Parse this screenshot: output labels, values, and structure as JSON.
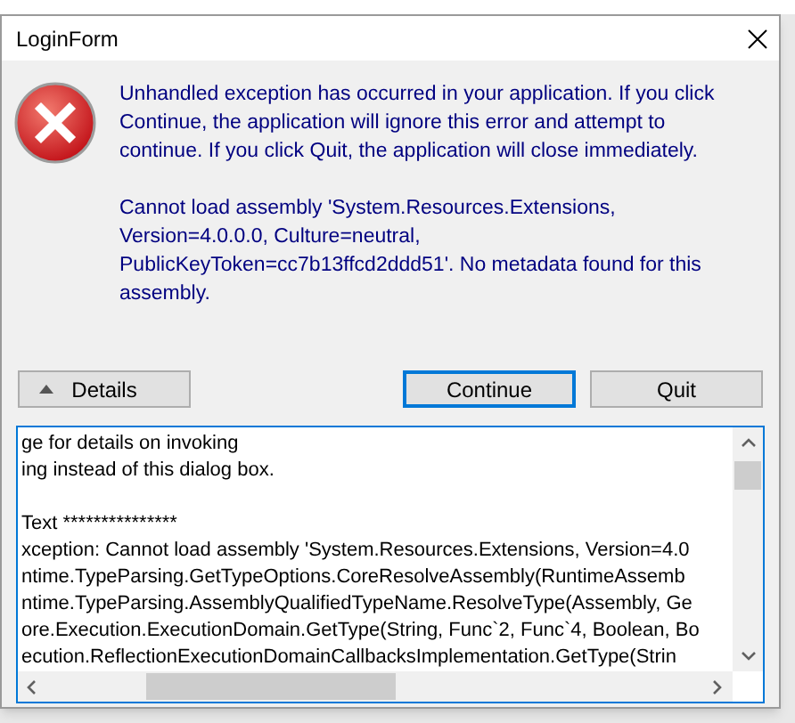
{
  "window": {
    "title": "LoginForm"
  },
  "message": [
    "Unhandled exception has occurred in your application. If you click Continue, the application will ignore this error and attempt to continue. If you click Quit, the application will close immediately.",
    "Cannot load assembly 'System.Resources.Extensions, Version=4.0.0.0, Culture=neutral, PublicKeyToken=cc7b13ffcd2ddd51'. No metadata found for this assembly."
  ],
  "buttons": [
    {
      "label": "Details",
      "kind": "toggle",
      "focused": false
    },
    {
      "label": "Continue",
      "kind": "plain",
      "focused": true
    },
    {
      "label": "Quit",
      "kind": "plain",
      "focused": false
    }
  ],
  "details_paragraphs": [
    [
      "ge for details on invoking",
      "ing instead of this dialog box."
    ],
    [
      "Text ***************",
      "xception: Cannot load assembly 'System.Resources.Extensions, Version=4.0",
      "ntime.TypeParsing.GetTypeOptions.CoreResolveAssembly(RuntimeAssemb",
      "ntime.TypeParsing.AssemblyQualifiedTypeName.ResolveType(Assembly, Ge",
      "ore.Execution.ExecutionDomain.GetType(String, Func`2, Func`4, Boolean, Bo",
      "ecution.ReflectionExecutionDomainCallbacksImplementation.GetType(Strin"
    ]
  ]
}
